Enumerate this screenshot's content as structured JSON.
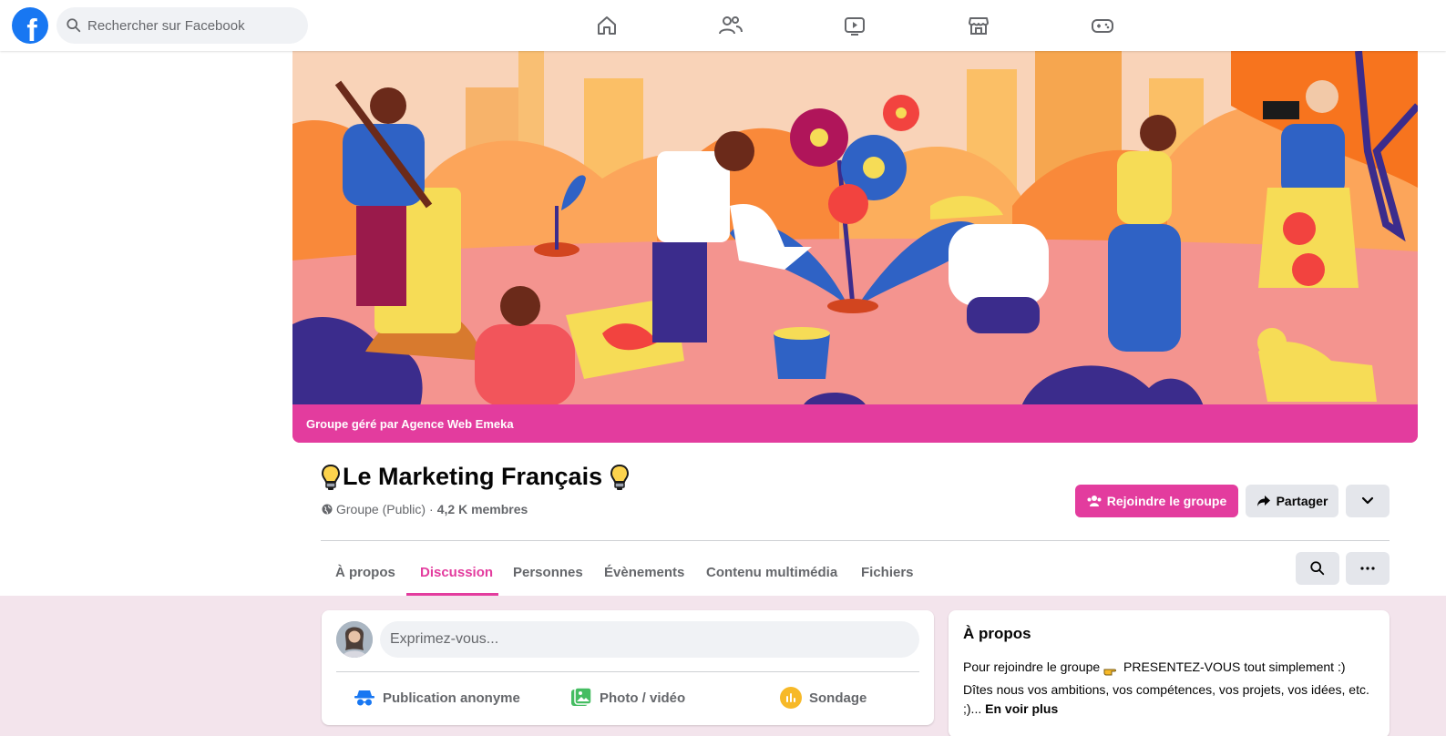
{
  "search": {
    "placeholder": "Rechercher sur Facebook"
  },
  "nav": [
    "home-icon",
    "friends-icon",
    "watch-icon",
    "marketplace-icon",
    "gaming-icon"
  ],
  "cover": {
    "managed_by": "Groupe géré par Agence Web Emeka"
  },
  "group": {
    "title": "Le Marketing Français",
    "privacy": "Groupe (Public)",
    "separator": "·",
    "members": "4,2 K membres"
  },
  "actions": {
    "join": "Rejoindre le groupe",
    "share": "Partager"
  },
  "tabs": [
    {
      "label": "À propos"
    },
    {
      "label": "Discussion",
      "active": true
    },
    {
      "label": "Personnes"
    },
    {
      "label": "Évènements"
    },
    {
      "label": "Contenu multimédia"
    },
    {
      "label": "Fichiers"
    }
  ],
  "composer": {
    "placeholder": "Exprimez-vous...",
    "actions": [
      {
        "label": "Publication anonyme",
        "icon": "anonymous-icon"
      },
      {
        "label": "Photo / vidéo",
        "icon": "photo-icon"
      },
      {
        "label": "Sondage",
        "icon": "poll-icon"
      }
    ]
  },
  "about": {
    "title": "À propos",
    "line1_before": "Pour rejoindre le groupe",
    "line1_after": "PRESENTEZ-VOUS tout simplement :)",
    "line2": "Dîtes nous vos ambitions, vos compétences, vos projets, vos idées, etc. ;)...",
    "see_more": "En voir plus"
  },
  "colors": {
    "brand": "#1877f2",
    "accent": "#e33c9e",
    "page_bg": "#f3e4ec"
  }
}
